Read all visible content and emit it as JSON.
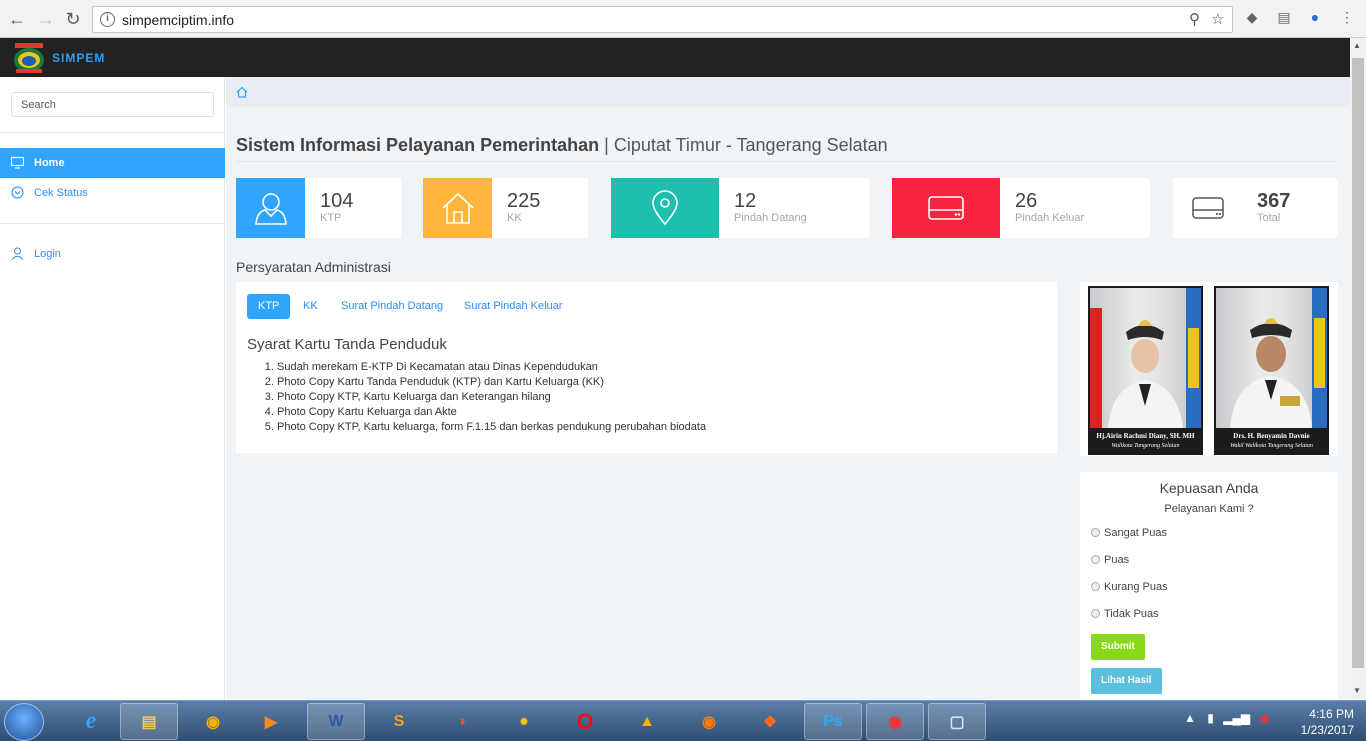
{
  "browser": {
    "url": "simpemciptim.info"
  },
  "app": {
    "brand": "SIMPEM"
  },
  "sidebar": {
    "search_placeholder": "Search",
    "items": [
      {
        "label": "Home",
        "icon": "monitor-icon",
        "active": true
      },
      {
        "label": "Cek Status",
        "icon": "chevron-circle-icon",
        "active": false
      },
      {
        "label": "Login",
        "icon": "user-icon",
        "active": false
      }
    ]
  },
  "main": {
    "title_bold": "Sistem Informasi Pelayanan Pemerintahan",
    "title_sep": " | ",
    "title_light": "Ciputat Timur - Tangerang Selatan",
    "stats": [
      {
        "value": "104",
        "label": "KTP",
        "color": "#30a5ff",
        "icon": "user-icon"
      },
      {
        "value": "225",
        "label": "KK",
        "color": "#ffb53e",
        "icon": "home-icon"
      },
      {
        "value": "12",
        "label": "Pindah Datang",
        "color": "#1ebfae",
        "icon": "map-pin-icon"
      },
      {
        "value": "26",
        "label": "Pindah Keluar",
        "color": "#f9243f",
        "icon": "hard-drive-icon"
      },
      {
        "value": "367",
        "label": "Total",
        "color": "#ffffff",
        "icon": "hard-drive-icon"
      }
    ],
    "section_label": "Persyaratan Administrasi",
    "tabs": [
      "KTP",
      "KK",
      "Surat Pindah Datang",
      "Surat Pindah Keluar"
    ],
    "req_title": "Syarat Kartu Tanda Penduduk",
    "requirements": [
      "Sudah merekam E-KTP Di Kecamatan atau Dinas Kependudukan",
      "Photo Copy Kartu Tanda Penduduk (KTP) dan Kartu Keluarga (KK)",
      "Photo Copy KTP, Kartu Keluarga dan Keterangan hilang",
      "Photo Copy Kartu Keluarga dan Akte",
      "Photo Copy KTP, Kartu keluarga, form F.1.15 dan berkas pendukung perubahan biodata"
    ]
  },
  "officials": [
    {
      "name": "Hj.Airin Rachmi Diany, SH. MH",
      "role": "Walikota Tangerang Selatan"
    },
    {
      "name": "Drs. H. Benyamin Davnie",
      "role": "Wakil Walikota Tangerang Selatan"
    }
  ],
  "survey": {
    "title": "Kepuasan Anda",
    "question": "Pelayanan Kami ?",
    "options": [
      "Sangat Puas",
      "Puas",
      "Kurang Puas",
      "Tidak Puas"
    ],
    "submit_label": "Submit",
    "results_label": "Lihat Hasil",
    "submit_color": "#8ad919",
    "results_color": "#5bc0de"
  },
  "taskbar": {
    "time": "4:16 PM",
    "date": "1/23/2017"
  }
}
